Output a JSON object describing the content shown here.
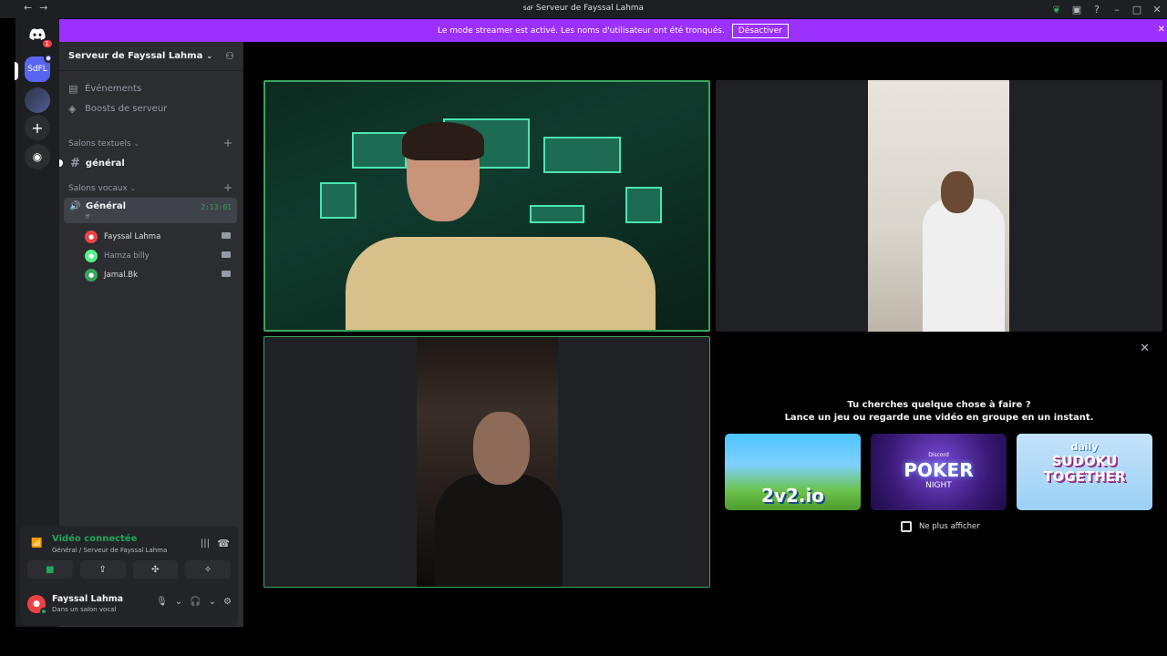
{
  "titlebar": {
    "back_icon": "arrow-left-icon",
    "forward_icon": "arrow-right-icon",
    "server_badge": "SdF",
    "title": "Serveur de Fayssal Lahma",
    "right_icons": [
      "nitro-leaf-icon",
      "inbox-icon",
      "help-icon",
      "minimize-icon",
      "maximize-icon",
      "close-icon"
    ]
  },
  "guilds": {
    "discord_badge": "1",
    "active_server_label": "SdFL",
    "add_icon": "plus-icon",
    "explore_icon": "compass-icon"
  },
  "banner": {
    "text": "Le mode streamer est activé. Les noms d'utilisateur ont été tronqués.",
    "button": "Désactiver"
  },
  "sidebar": {
    "server_name": "Serveur de Fayssal Lahma",
    "events": "Événements",
    "boosts": "Boosts de serveur",
    "text_category": "Salons textuels",
    "text_channel": "général",
    "voice_category": "Salons vocaux",
    "voice_channel": {
      "name": "Général",
      "sub": "ff",
      "time": "2:13:01"
    },
    "members": [
      {
        "name": "Fayssal Lahma",
        "color": "#ed4245"
      },
      {
        "name": "Hamza billy",
        "color": "#57f287"
      },
      {
        "name": "Jamal.Bk",
        "color": "#3ba55d"
      }
    ]
  },
  "panel": {
    "status_title": "Vidéo connectée",
    "status_sub": "Général / Serveur de Fayssal Lahma",
    "user_name": "Fayssal Lahma",
    "user_status": "Dans un salon vocal"
  },
  "activity": {
    "question": "Tu cherches quelque chose à faire ?",
    "subtitle": "Lance un jeu ou regarde une vidéo en groupe en un instant.",
    "cards": [
      {
        "title": "2v2.io"
      },
      {
        "brand": "Discord",
        "title": "POKER",
        "sub": "NIGHT"
      },
      {
        "pre": "daily",
        "title": "SUDOKU TOGETHER"
      }
    ],
    "hide_label": "Ne plus afficher"
  },
  "colors": {
    "banner": "#9b30ff",
    "speaking": "#3ba55d",
    "accent": "#5865f2"
  }
}
